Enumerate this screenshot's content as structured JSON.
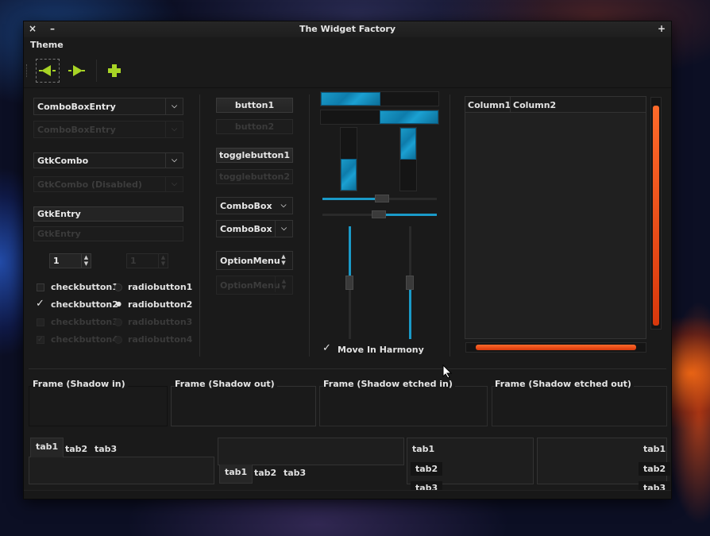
{
  "window": {
    "title": "The Widget Factory",
    "close_glyph": "×",
    "minimize_glyph": "–",
    "maximize_glyph": "+"
  },
  "menu": {
    "theme": "Theme"
  },
  "col1": {
    "comboboxentry": "ComboBoxEntry",
    "comboboxentry_disabled": "ComboBoxEntry",
    "gtkcombo": "GtkCombo",
    "gtkcombo_disabled": "GtkCombo (Disabled)",
    "gtkentry": "GtkEntry",
    "gtkentry_disabled": "GtkEntry",
    "spin_value": "1",
    "spin_disabled_value": "1",
    "checkbutton1": "checkbutton1",
    "checkbutton2": "checkbutton2",
    "checkbutton3": "checkbutton3",
    "checkbutton4": "checkbutton4",
    "radiobutton1": "radiobutton1",
    "radiobutton2": "radiobutton2",
    "radiobutton3": "radiobutton3",
    "radiobutton4": "radiobutton4",
    "check_glyph": "✓",
    "radio_dot": "●"
  },
  "col2": {
    "button1": "button1",
    "button2": "button2",
    "togglebutton1": "togglebutton1",
    "togglebutton2": "togglebutton2",
    "combobox1": "ComboBox",
    "combobox2": "ComboBox",
    "optionmenu1": "OptionMenu",
    "optionmenu2": "OptionMenu"
  },
  "col3": {
    "move_in_harmony": "Move In Harmony",
    "hscale1_value": 0.5,
    "hscale2_value": 0.35,
    "vscale1_value": 0.25,
    "vscale2_value": 0.25
  },
  "tree": {
    "columns": [
      "Column1",
      "Column2"
    ]
  },
  "frames": {
    "shadow_in": "Frame (Shadow in)",
    "shadow_out": "Frame (Shadow out)",
    "shadow_etched_in": "Frame (Shadow etched in)",
    "shadow_etched_out": "Frame (Shadow etched out)"
  },
  "notebooks": {
    "top": [
      "tab1",
      "tab2",
      "tab3"
    ],
    "bottom": [
      "tab1",
      "tab2",
      "tab3"
    ],
    "left": [
      "tab1",
      "tab2",
      "tab3"
    ],
    "right": [
      "tab1",
      "tab2",
      "tab3"
    ]
  },
  "colors": {
    "accent_green": "#a8d426",
    "accent_blue": "#1a9ac8",
    "accent_orange": "#ff5a1a"
  }
}
